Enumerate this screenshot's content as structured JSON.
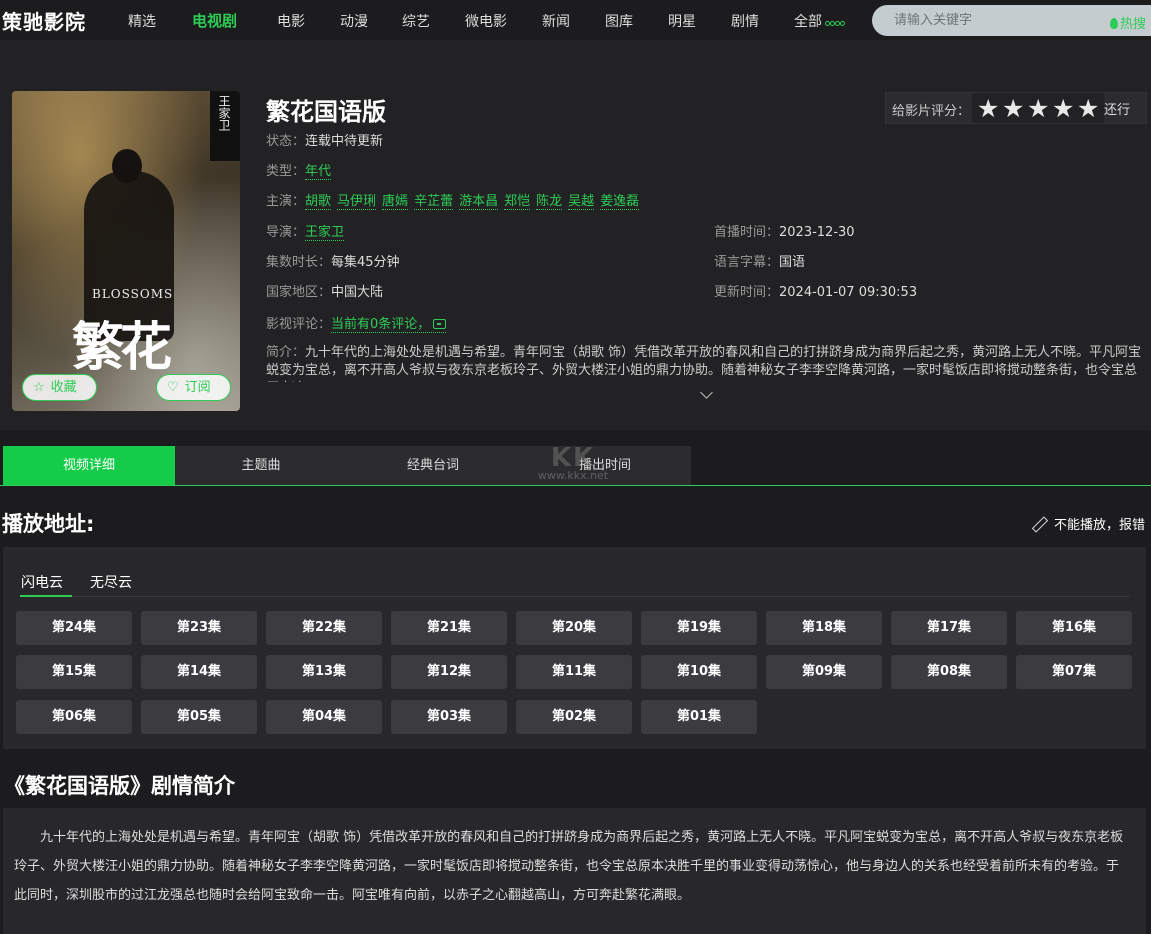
{
  "header": {
    "logo": "策驰影院",
    "nav": [
      {
        "label": "精选",
        "active": false
      },
      {
        "label": "电视剧",
        "active": true
      },
      {
        "label": "电影",
        "active": false
      },
      {
        "label": "动漫",
        "active": false
      },
      {
        "label": "综艺",
        "active": false
      },
      {
        "label": "微电影",
        "active": false
      },
      {
        "label": "新闻",
        "active": false
      },
      {
        "label": "图库",
        "active": false
      },
      {
        "label": "明星",
        "active": false
      },
      {
        "label": "剧情",
        "active": false
      },
      {
        "label": "全部",
        "active": false
      }
    ],
    "search_placeholder": "请输入关键字",
    "hot_label": "热搜"
  },
  "detail": {
    "title": "繁花国语版",
    "poster": {
      "banner_text": "王家卫",
      "title_en": "BLOSSOMS",
      "title_cn": "繁花",
      "fav_label": "收藏",
      "subscribe_label": "订阅"
    },
    "status_label": "状态：",
    "status": "连载中待更新",
    "type_label": "类型：",
    "type": "年代",
    "cast_label": "主演：",
    "cast": [
      "胡歌",
      "马伊琍",
      "唐嫣",
      "辛芷蕾",
      "游本昌",
      "郑恺",
      "陈龙",
      "吴越",
      "姜逸磊"
    ],
    "director_label": "导演：",
    "director": "王家卫",
    "premiere_label": "首播时间：",
    "premiere": "2023-12-30",
    "duration_label": "集数时长：",
    "duration": "每集45分钟",
    "language_label": "语言字幕：",
    "language": "国语",
    "region_label": "国家地区：",
    "region": "中国大陆",
    "updated_label": "更新时间：",
    "updated": "2024-01-07 09:30:53",
    "comment_label": "影视评论：",
    "comment": "当前有0条评论，",
    "summary_label": "简介：",
    "summary": "九十年代的上海处处是机遇与希望。青年阿宝（胡歌 饰）凭借改革开放的春风和自己的打拼跻身成为商界后起之秀，黄河路上无人不晓。平凡阿宝蜕变为宝总，离不开高人爷叔与夜东京老板玲子、外贸大楼汪小姐的鼎力协助。随着神秘女子李李空降黄河路，一家时髦饭店即将搅动整条街，也令宝总原本决..."
  },
  "rating": {
    "label": "给影片评分：",
    "stars": 5,
    "text": "还行"
  },
  "tabs": [
    {
      "label": "视频详细",
      "active": true
    },
    {
      "label": "主题曲",
      "active": false
    },
    {
      "label": "经典台词",
      "active": false
    },
    {
      "label": "播出时间",
      "active": false
    }
  ],
  "watermark": {
    "logo": "KK",
    "url": "www.kkx.net"
  },
  "play": {
    "title": "播放地址:",
    "report": "不能播放，报错",
    "sources": [
      {
        "label": "闪电云",
        "active": true
      },
      {
        "label": "无尽云",
        "active": false
      }
    ],
    "episodes": [
      "第24集",
      "第23集",
      "第22集",
      "第21集",
      "第20集",
      "第19集",
      "第18集",
      "第17集",
      "第16集",
      "第15集",
      "第14集",
      "第13集",
      "第12集",
      "第11集",
      "第10集",
      "第09集",
      "第08集",
      "第07集",
      "第06集",
      "第05集",
      "第04集",
      "第03集",
      "第02集",
      "第01集"
    ]
  },
  "plot": {
    "title": "《繁花国语版》剧情简介",
    "text": "九十年代的上海处处是机遇与希望。青年阿宝（胡歌 饰）凭借改革开放的春风和自己的打拼跻身成为商界后起之秀，黄河路上无人不晓。平凡阿宝蜕变为宝总，离不开高人爷叔与夜东京老板玲子、外贸大楼汪小姐的鼎力协助。随着神秘女子李李空降黄河路，一家时髦饭店即将搅动整条街，也令宝总原本决胜千里的事业变得动荡惊心，他与身边人的关系也经受着前所未有的考验。于此同时，深圳股市的过江龙强总也随时会给阿宝致命一击。阿宝唯有向前，以赤子之心翻越高山，方可奔赴繁花满眼。"
  },
  "colors": {
    "accent": "#2ecc55",
    "tab_active": "#14cc4a",
    "background": "#1c1c1e",
    "panel": "#28282b",
    "episode_button": "#3c3c40"
  }
}
